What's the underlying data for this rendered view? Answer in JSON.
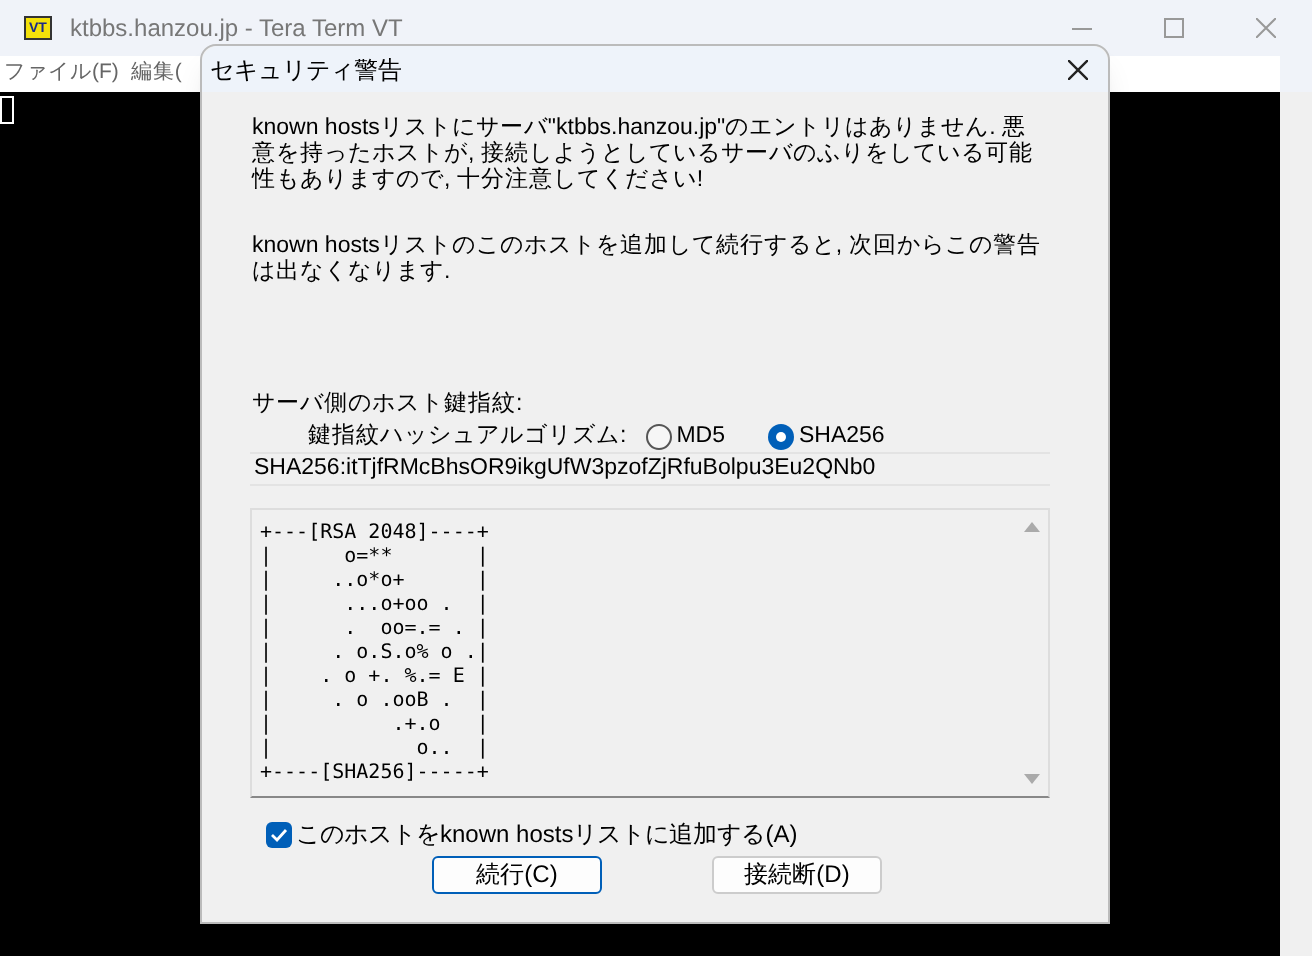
{
  "window": {
    "title": "ktbbs.hanzou.jp - Tera Term VT",
    "app_icon": "VT"
  },
  "menu": [
    "ファイル(F)",
    "編集("
  ],
  "dialog": {
    "title": "セキュリティ警告",
    "message": "known hostsリストにサーバ\"ktbbs.hanzou.jp\"のエントリはありません. 悪意を持ったホストが, 接続しようとしているサーバのふりをしている可能性もありますので, 十分注意してください!",
    "note": "known hostsリストのこのホストを追加して続行すると, 次回からこの警告は出なくなります.",
    "fingerprint_label": "サーバ側のホスト鍵指紋:",
    "hash_label": "鍵指紋ハッシュアルゴリズム:",
    "hash_options": [
      {
        "label": "MD5",
        "selected": false
      },
      {
        "label": "SHA256",
        "selected": true
      }
    ],
    "fingerprint": "SHA256:itTjfRMcBhsOR9ikgUfW3pzofZjRfuBolpu3Eu2QNb0",
    "randomart": [
      "+---[RSA 2048]----+",
      "|      o=**       |",
      "|     ..o*o+      |",
      "|      ...o+oo .  |",
      "|      .  oo=.= . |",
      "|     . o.S.o% o .|",
      "|    . o +. %.= E |",
      "|     . o .ooB .  |",
      "|          .+.o   |",
      "|            o..  |",
      "+----[SHA256]-----+"
    ],
    "add_checkbox": {
      "label": "このホストをknown hostsリストに追加する(A)",
      "checked": true
    },
    "buttons": [
      {
        "label": "続行(C)",
        "default": true
      },
      {
        "label": "接続断(D)",
        "default": false
      }
    ]
  }
}
